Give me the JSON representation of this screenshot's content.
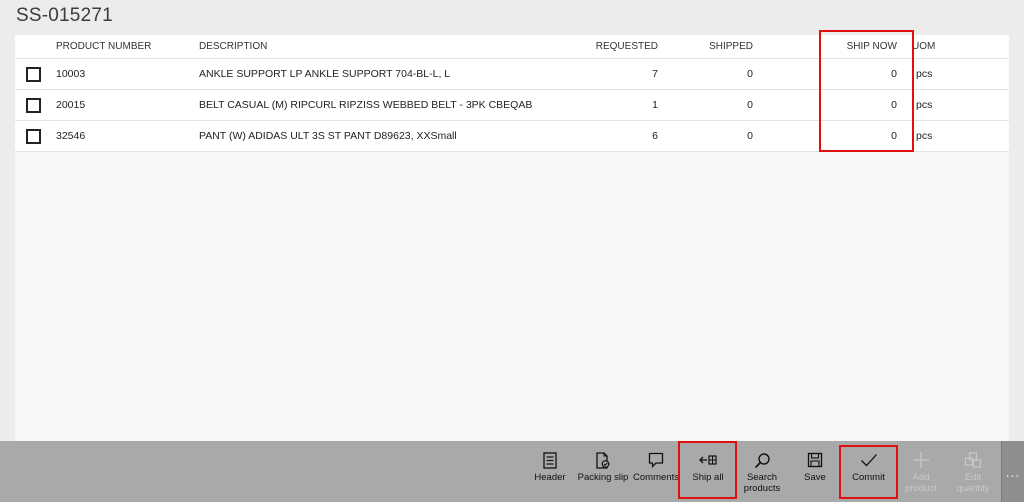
{
  "document": {
    "title": "SS-015271"
  },
  "grid": {
    "columns": {
      "product_number": "PRODUCT NUMBER",
      "description": "DESCRIPTION",
      "requested": "REQUESTED",
      "shipped": "SHIPPED",
      "ship_now": "SHIP NOW",
      "uom": "UOM"
    },
    "rows": [
      {
        "product_number": "10003",
        "description": "ANKLE SUPPORT LP ANKLE SUPPORT 704-BL-L, L",
        "requested": "7",
        "shipped": "0",
        "ship_now": "0",
        "uom": "pcs"
      },
      {
        "product_number": "20015",
        "description": "BELT CASUAL (M) RIPCURL RIPZISS WEBBED BELT - 3PK CBEQAB",
        "requested": "1",
        "shipped": "0",
        "ship_now": "0",
        "uom": "pcs"
      },
      {
        "product_number": "32546",
        "description": "PANT (W) ADIDAS ULT 3S ST PANT D89623, XXSmall",
        "requested": "6",
        "shipped": "0",
        "ship_now": "0",
        "uom": "pcs"
      }
    ]
  },
  "toolbar": {
    "header": {
      "label": "Header",
      "icon": "header-icon"
    },
    "packing_slip": {
      "label": "Packing slip",
      "icon": "packing-slip-icon"
    },
    "comments": {
      "label": "Comments",
      "icon": "comments-icon"
    },
    "ship_all": {
      "label": "Ship all",
      "icon": "ship-all-icon"
    },
    "search_products": {
      "label": "Search\nproducts",
      "icon": "search-icon"
    },
    "save": {
      "label": "Save",
      "icon": "save-icon"
    },
    "commit": {
      "label": "Commit",
      "icon": "checkmark-icon"
    },
    "add_product": {
      "label": "Add\nproduct",
      "icon": "plus-icon",
      "enabled": false
    },
    "edit_quantity": {
      "label": "Edit\nquantity",
      "icon": "edit-quantity-icon",
      "enabled": false
    },
    "more": {
      "label": "...",
      "icon": "more-icon"
    }
  },
  "colors": {
    "highlight": "#e01010",
    "toolbar_bg": "#a9a9a9"
  }
}
